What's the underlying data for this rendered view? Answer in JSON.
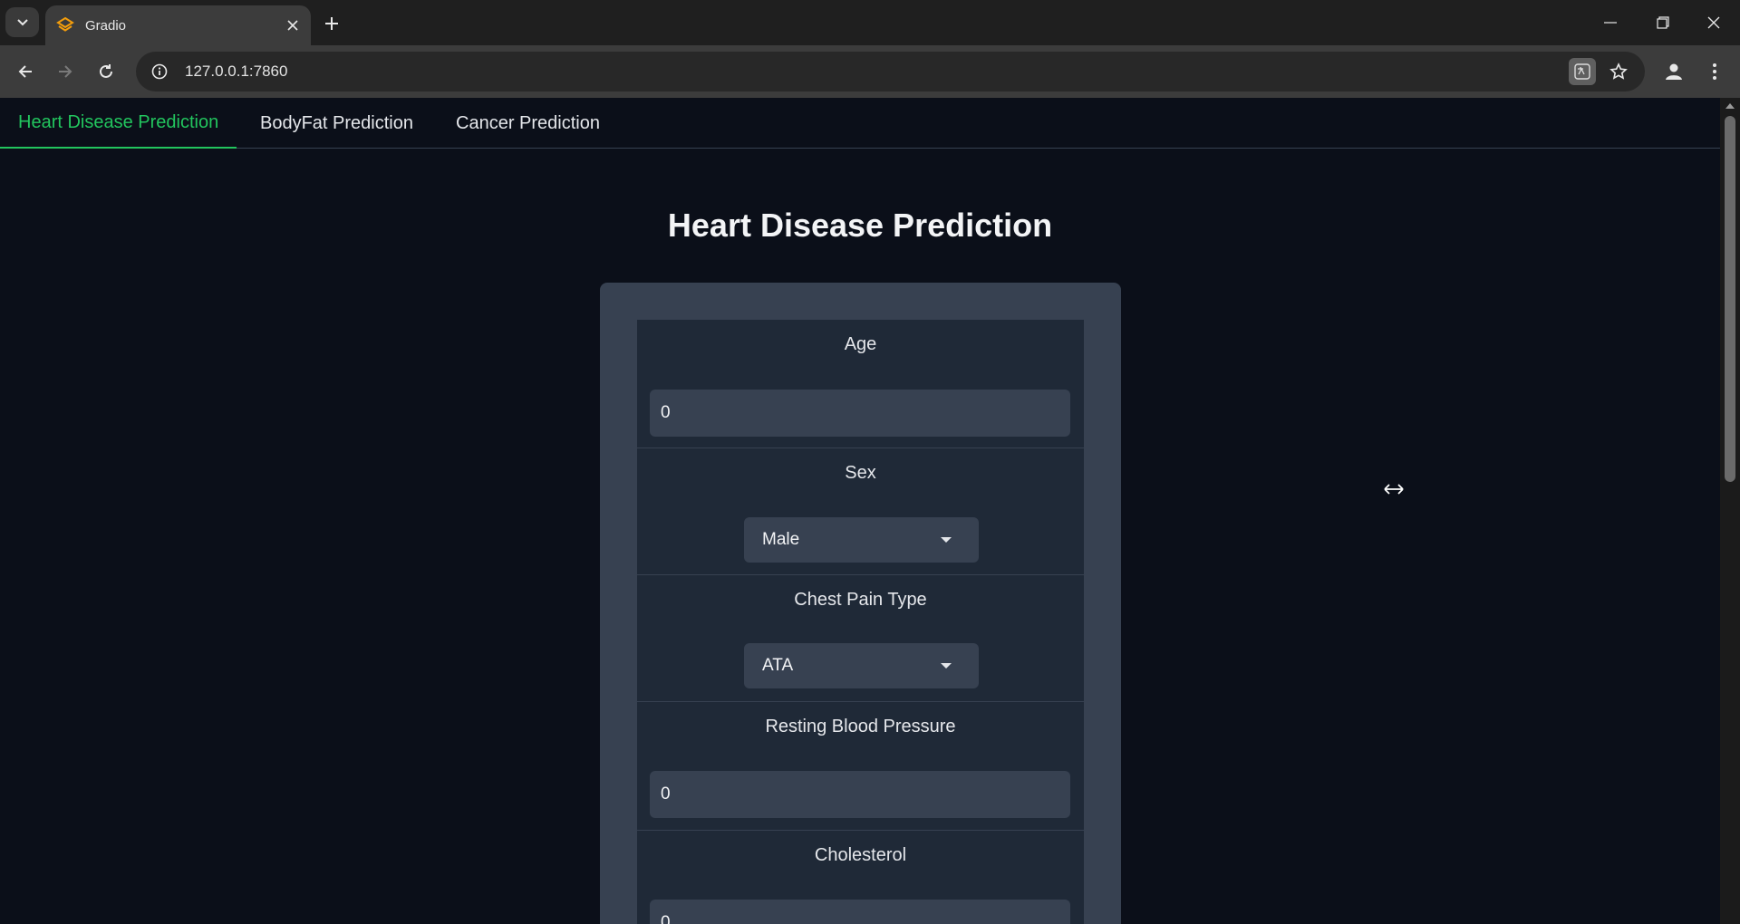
{
  "browser": {
    "tab_title": "Gradio",
    "url": "127.0.0.1:7860"
  },
  "app": {
    "tabs": [
      {
        "label": "Heart Disease Prediction",
        "active": true
      },
      {
        "label": "BodyFat Prediction",
        "active": false
      },
      {
        "label": "Cancer Prediction",
        "active": false
      }
    ],
    "title": "Heart Disease Prediction",
    "form": {
      "age": {
        "label": "Age",
        "value": "0"
      },
      "sex": {
        "label": "Sex",
        "value": "Male"
      },
      "chest_pain_type": {
        "label": "Chest Pain Type",
        "value": "ATA"
      },
      "resting_bp": {
        "label": "Resting Blood Pressure",
        "value": "0"
      },
      "cholesterol": {
        "label": "Cholesterol",
        "value": "0"
      }
    }
  },
  "colors": {
    "accent": "#22c55e",
    "page_bg": "#0b0f19",
    "panel_bg": "#1f2937",
    "input_bg": "#374151"
  }
}
